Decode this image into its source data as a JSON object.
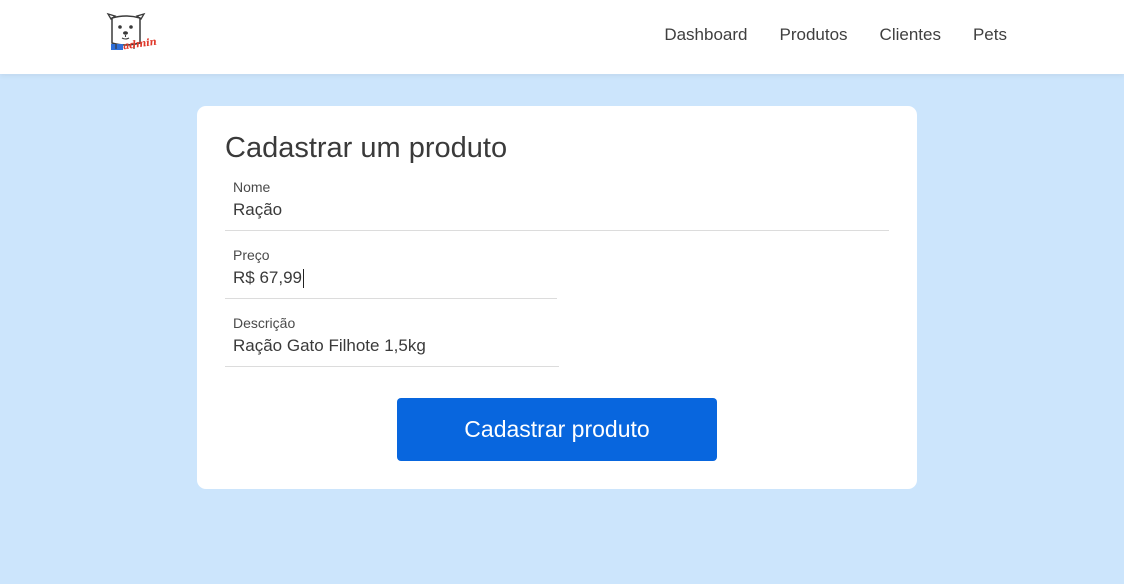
{
  "header": {
    "logo_alt_icon": "dog-admin-logo",
    "logo_text": "admin",
    "nav": [
      "Dashboard",
      "Produtos",
      "Clientes",
      "Pets"
    ]
  },
  "form": {
    "title": "Cadastrar um produto",
    "fields": [
      {
        "label": "Nome",
        "value": "Ração"
      },
      {
        "label": "Preço",
        "value": "R$ 67,99"
      },
      {
        "label": "Descrição",
        "value": "Ração Gato Filhote 1,5kg"
      }
    ],
    "submit_label": "Cadastrar produto"
  },
  "colors": {
    "page_background": "#cce5fc",
    "primary_button": "#0866de",
    "logo_accent": "#e0392b"
  }
}
